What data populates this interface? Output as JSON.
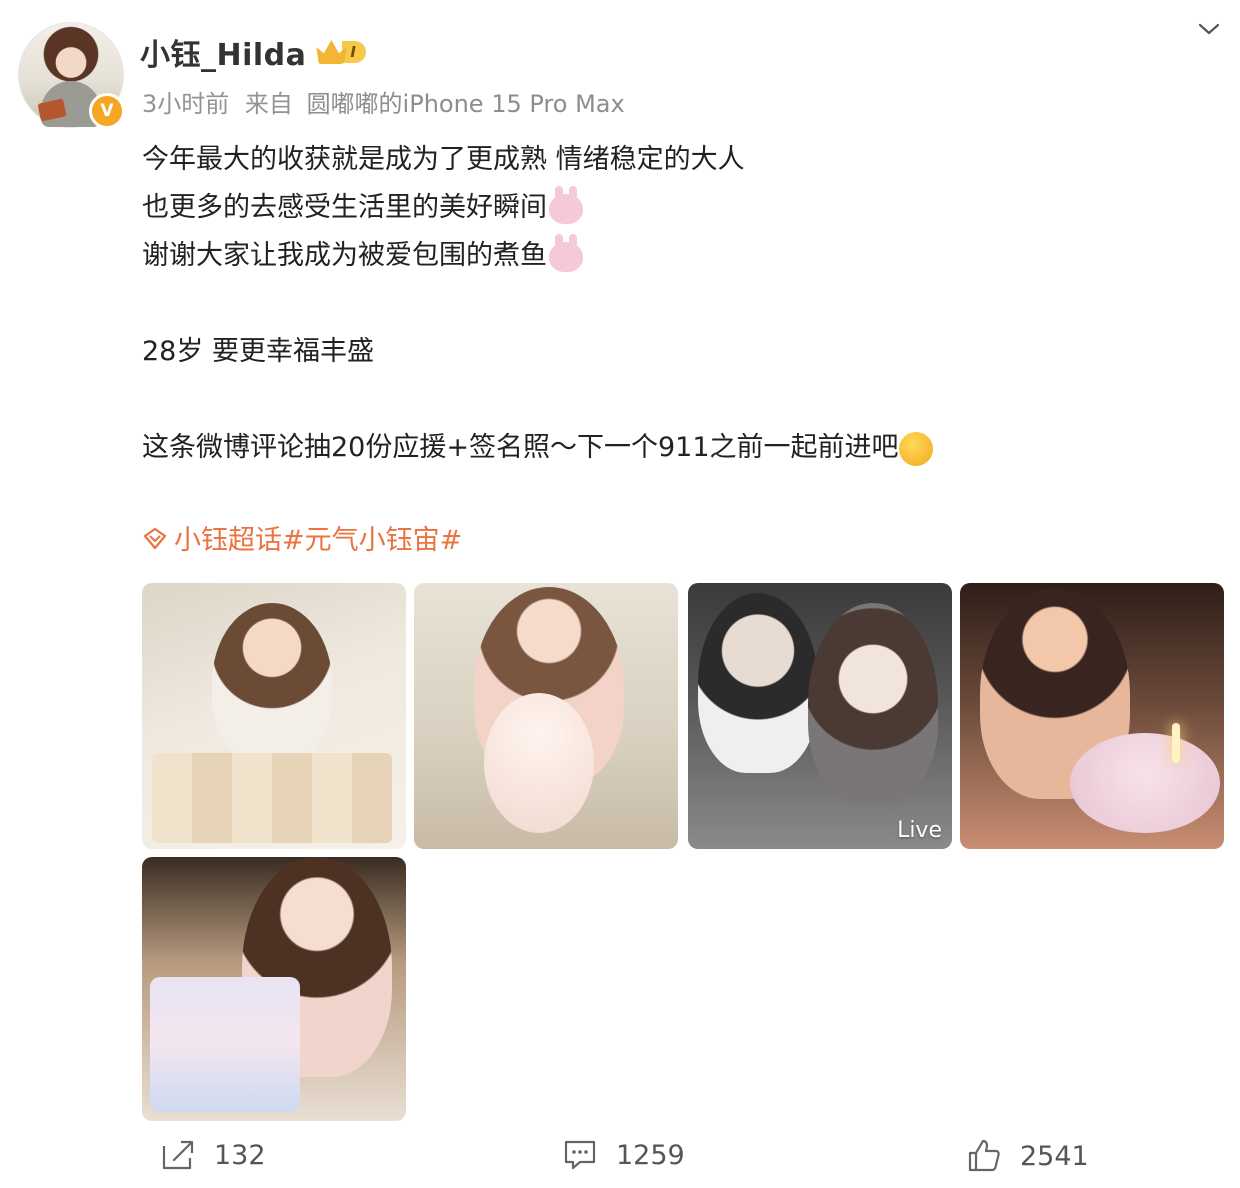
{
  "user": {
    "name": "小钰_Hilda",
    "level": "I",
    "verified_badge": "V"
  },
  "meta": {
    "time": "3小时前",
    "from_label": "来自",
    "source": "圆嘟嘟的iPhone 15 Pro Max"
  },
  "post": {
    "lines": [
      "今年最大的收获就是成为了更成熟 情绪稳定的大人",
      "也更多的去感受生活里的美好瞬间",
      "谢谢大家让我成为被爱包围的煮鱼",
      "28岁 要更幸福丰盛",
      "这条微博评论抽20份应援+签名照～下一个911之前一起前进吧"
    ],
    "emoji": [
      "bunny-emoji",
      "bunny-emoji",
      "kiss-emoji"
    ]
  },
  "topic": {
    "text": "小钰超话#元气小钰宙#",
    "icon": "diamond-icon"
  },
  "photos": [
    {
      "name": "photo-gifts",
      "live": ""
    },
    {
      "name": "photo-cake-blowing",
      "live": ""
    },
    {
      "name": "photo-couple-selfie",
      "live": "Live"
    },
    {
      "name": "photo-candle-wish",
      "live": ""
    },
    {
      "name": "photo-holding-cake",
      "live": ""
    }
  ],
  "actions": {
    "share_count": "132",
    "comment_count": "1259",
    "like_count": "2541"
  },
  "colors": {
    "accent": "#eb7340",
    "badge": "#f5a623",
    "text": "#333333",
    "meta": "#939393"
  }
}
